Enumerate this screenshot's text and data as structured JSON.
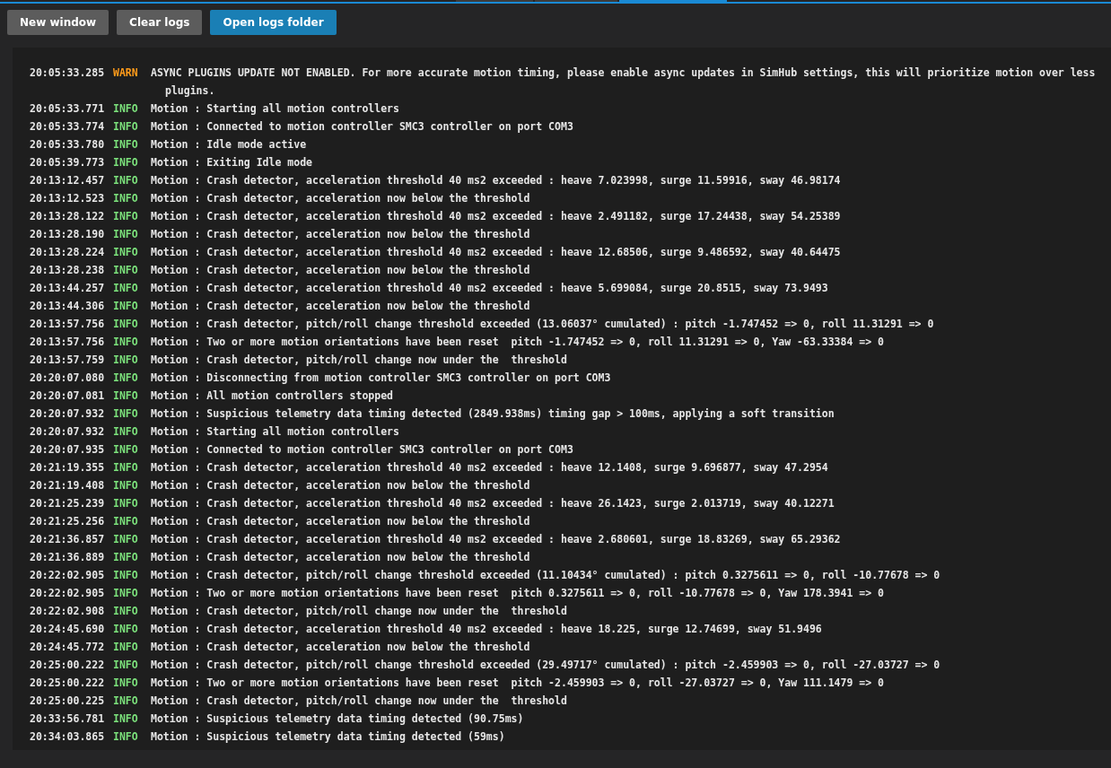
{
  "toolbar": {
    "buttons": [
      {
        "label": "New window",
        "kind": "secondary"
      },
      {
        "label": "Clear logs",
        "kind": "secondary"
      },
      {
        "label": "Open logs folder",
        "kind": "primary"
      }
    ]
  },
  "log": {
    "entries": [
      {
        "time": "20:05:33.285",
        "level": "WARN",
        "kind": "warn",
        "message": "ASYNC PLUGINS UPDATE NOT ENABLED. For more accurate motion timing, please enable async updates in SimHub settings, this will prioritize motion over less plugins."
      },
      {
        "time": "20:05:33.771",
        "level": "INFO",
        "kind": "info",
        "message": "Motion : Starting all motion controllers"
      },
      {
        "time": "20:05:33.774",
        "level": "INFO",
        "kind": "info",
        "message": "Motion : Connected to motion controller SMC3 controller on port COM3"
      },
      {
        "time": "20:05:33.780",
        "level": "INFO",
        "kind": "info",
        "message": "Motion : Idle mode active"
      },
      {
        "time": "20:05:39.773",
        "level": "INFO",
        "kind": "info",
        "message": "Motion : Exiting Idle mode"
      },
      {
        "time": "20:13:12.457",
        "level": "INFO",
        "kind": "info",
        "message": "Motion : Crash detector, acceleration threshold 40 ms2 exceeded : heave 7.023998, surge 11.59916, sway 46.98174"
      },
      {
        "time": "20:13:12.523",
        "level": "INFO",
        "kind": "info",
        "message": "Motion : Crash detector, acceleration now below the threshold"
      },
      {
        "time": "20:13:28.122",
        "level": "INFO",
        "kind": "info",
        "message": "Motion : Crash detector, acceleration threshold 40 ms2 exceeded : heave 2.491182, surge 17.24438, sway 54.25389"
      },
      {
        "time": "20:13:28.190",
        "level": "INFO",
        "kind": "info",
        "message": "Motion : Crash detector, acceleration now below the threshold"
      },
      {
        "time": "20:13:28.224",
        "level": "INFO",
        "kind": "info",
        "message": "Motion : Crash detector, acceleration threshold 40 ms2 exceeded : heave 12.68506, surge 9.486592, sway 40.64475"
      },
      {
        "time": "20:13:28.238",
        "level": "INFO",
        "kind": "info",
        "message": "Motion : Crash detector, acceleration now below the threshold"
      },
      {
        "time": "20:13:44.257",
        "level": "INFO",
        "kind": "info",
        "message": "Motion : Crash detector, acceleration threshold 40 ms2 exceeded : heave 5.699084, surge 20.8515, sway 73.9493"
      },
      {
        "time": "20:13:44.306",
        "level": "INFO",
        "kind": "info",
        "message": "Motion : Crash detector, acceleration now below the threshold"
      },
      {
        "time": "20:13:57.756",
        "level": "INFO",
        "kind": "info",
        "message": "Motion : Crash detector, pitch/roll change threshold exceeded (13.06037° cumulated) : pitch -1.747452 => 0, roll 11.31291 => 0"
      },
      {
        "time": "20:13:57.756",
        "level": "INFO",
        "kind": "info",
        "message": "Motion : Two or more motion orientations have been reset  pitch -1.747452 => 0, roll 11.31291 => 0, Yaw -63.33384 => 0"
      },
      {
        "time": "20:13:57.759",
        "level": "INFO",
        "kind": "info",
        "message": "Motion : Crash detector, pitch/roll change now under the  threshold"
      },
      {
        "time": "20:20:07.080",
        "level": "INFO",
        "kind": "info",
        "message": "Motion : Disconnecting from motion controller SMC3 controller on port COM3"
      },
      {
        "time": "20:20:07.081",
        "level": "INFO",
        "kind": "info",
        "message": "Motion : All motion controllers stopped"
      },
      {
        "time": "20:20:07.932",
        "level": "INFO",
        "kind": "info",
        "message": "Motion : Suspicious telemetry data timing detected (2849.938ms) timing gap > 100ms, applying a soft transition"
      },
      {
        "time": "20:20:07.932",
        "level": "INFO",
        "kind": "info",
        "message": "Motion : Starting all motion controllers"
      },
      {
        "time": "20:20:07.935",
        "level": "INFO",
        "kind": "info",
        "message": "Motion : Connected to motion controller SMC3 controller on port COM3"
      },
      {
        "time": "20:21:19.355",
        "level": "INFO",
        "kind": "info",
        "message": "Motion : Crash detector, acceleration threshold 40 ms2 exceeded : heave 12.1408, surge 9.696877, sway 47.2954"
      },
      {
        "time": "20:21:19.408",
        "level": "INFO",
        "kind": "info",
        "message": "Motion : Crash detector, acceleration now below the threshold"
      },
      {
        "time": "20:21:25.239",
        "level": "INFO",
        "kind": "info",
        "message": "Motion : Crash detector, acceleration threshold 40 ms2 exceeded : heave 26.1423, surge 2.013719, sway 40.12271"
      },
      {
        "time": "20:21:25.256",
        "level": "INFO",
        "kind": "info",
        "message": "Motion : Crash detector, acceleration now below the threshold"
      },
      {
        "time": "20:21:36.857",
        "level": "INFO",
        "kind": "info",
        "message": "Motion : Crash detector, acceleration threshold 40 ms2 exceeded : heave 2.680601, surge 18.83269, sway 65.29362"
      },
      {
        "time": "20:21:36.889",
        "level": "INFO",
        "kind": "info",
        "message": "Motion : Crash detector, acceleration now below the threshold"
      },
      {
        "time": "20:22:02.905",
        "level": "INFO",
        "kind": "info",
        "message": "Motion : Crash detector, pitch/roll change threshold exceeded (11.10434° cumulated) : pitch 0.3275611 => 0, roll -10.77678 => 0"
      },
      {
        "time": "20:22:02.905",
        "level": "INFO",
        "kind": "info",
        "message": "Motion : Two or more motion orientations have been reset  pitch 0.3275611 => 0, roll -10.77678 => 0, Yaw 178.3941 => 0"
      },
      {
        "time": "20:22:02.908",
        "level": "INFO",
        "kind": "info",
        "message": "Motion : Crash detector, pitch/roll change now under the  threshold"
      },
      {
        "time": "20:24:45.690",
        "level": "INFO",
        "kind": "info",
        "message": "Motion : Crash detector, acceleration threshold 40 ms2 exceeded : heave 18.225, surge 12.74699, sway 51.9496"
      },
      {
        "time": "20:24:45.772",
        "level": "INFO",
        "kind": "info",
        "message": "Motion : Crash detector, acceleration now below the threshold"
      },
      {
        "time": "20:25:00.222",
        "level": "INFO",
        "kind": "info",
        "message": "Motion : Crash detector, pitch/roll change threshold exceeded (29.49717° cumulated) : pitch -2.459903 => 0, roll -27.03727 => 0"
      },
      {
        "time": "20:25:00.222",
        "level": "INFO",
        "kind": "info",
        "message": "Motion : Two or more motion orientations have been reset  pitch -2.459903 => 0, roll -27.03727 => 0, Yaw 111.1479 => 0"
      },
      {
        "time": "20:25:00.225",
        "level": "INFO",
        "kind": "info",
        "message": "Motion : Crash detector, pitch/roll change now under the  threshold"
      },
      {
        "time": "20:33:56.781",
        "level": "INFO",
        "kind": "info",
        "message": "Motion : Suspicious telemetry data timing detected (90.75ms)"
      },
      {
        "time": "20:34:03.865",
        "level": "INFO",
        "kind": "info",
        "message": "Motion : Suspicious telemetry data timing detected (59ms)"
      }
    ]
  }
}
